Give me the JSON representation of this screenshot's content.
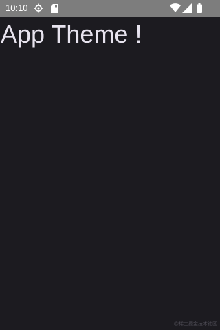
{
  "status_bar": {
    "time": "10:10",
    "left_icons": [
      "settings-icon",
      "sd-card-icon"
    ],
    "right_icons": [
      "wifi-icon",
      "cellular-signal-icon",
      "battery-icon"
    ],
    "background_color": "#7d7d7d"
  },
  "main": {
    "title": "App Theme !",
    "background_color": "#1c1b20",
    "text_color": "#e7e3ee"
  },
  "watermark": {
    "text": "@稀土掘金技术社区"
  }
}
